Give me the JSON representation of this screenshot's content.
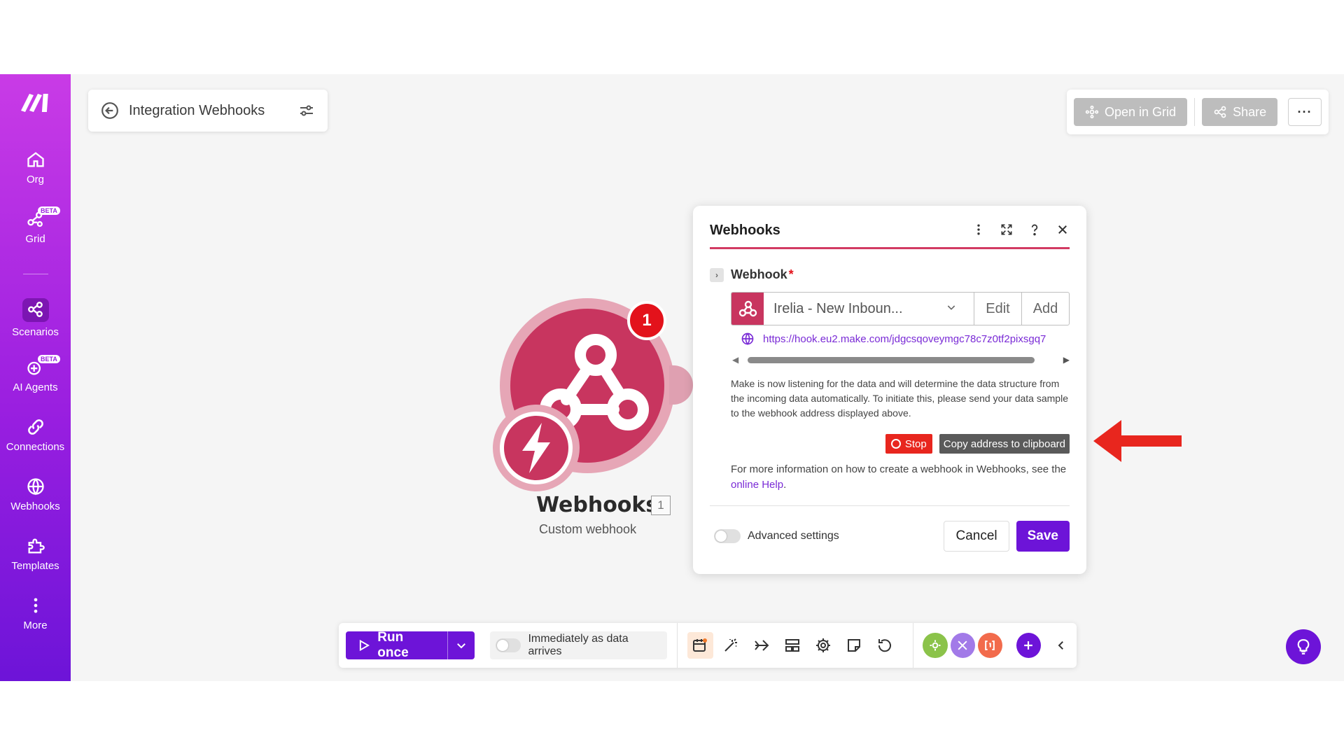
{
  "sidebar": {
    "items": [
      {
        "label": "Org",
        "icon": "home-icon"
      },
      {
        "label": "Grid",
        "icon": "grid-icon",
        "badge": "BETA"
      },
      {
        "label": "Scenarios",
        "icon": "scenarios-icon"
      },
      {
        "label": "AI Agents",
        "icon": "ai-agents-icon",
        "badge": "BETA"
      },
      {
        "label": "Connections",
        "icon": "link-icon"
      },
      {
        "label": "Webhooks",
        "icon": "globe-icon"
      },
      {
        "label": "Templates",
        "icon": "puzzle-icon"
      },
      {
        "label": "More",
        "icon": "vertical-dots-icon"
      }
    ]
  },
  "header": {
    "title": "Integration Webhooks"
  },
  "topbar": {
    "open_in_grid": "Open in Grid",
    "share": "Share",
    "more": "···"
  },
  "module": {
    "name": "Webhooks",
    "count": "1",
    "subtitle": "Custom webhook",
    "badge": "1"
  },
  "dialog": {
    "title": "Webhooks",
    "field_label": "Webhook",
    "required_mark": "*",
    "selected": "Irelia - New Inboun...",
    "edit": "Edit",
    "add": "Add",
    "url": "https://hook.eu2.make.com/jdgcsqoveymgc78c7z0tf2pixsgq7",
    "info": "Make is now listening for the data and will determine the data structure from the incoming data automatically. To initiate this, please send your data sample to the webhook address displayed above.",
    "stop": "Stop",
    "copy": "Copy address to clipboard",
    "more_info_prefix": "For more information on how to create a webhook in Webhooks, see the ",
    "more_info_link": "online Help",
    "more_info_suffix": ".",
    "advanced": "Advanced settings",
    "cancel": "Cancel",
    "save": "Save"
  },
  "bottombar": {
    "run_once": "Run once",
    "schedule": "Immediately as data arrives"
  },
  "colors": {
    "brand": "#6d14d8",
    "webhook": "#c8355f",
    "stop": "#e8261e",
    "arrow": "#e8261e"
  }
}
